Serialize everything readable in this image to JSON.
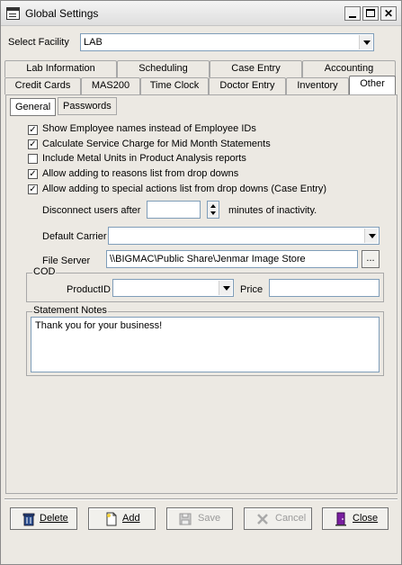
{
  "window": {
    "title": "Global Settings"
  },
  "facility": {
    "label": "Select Facility",
    "value": "LAB"
  },
  "tabs_row1": [
    "Lab Information",
    "Scheduling",
    "Case Entry",
    "Accounting"
  ],
  "tabs_row2": [
    "Credit Cards",
    "MAS200",
    "Time Clock",
    "Doctor Entry",
    "Inventory",
    "Other"
  ],
  "active_tab": "Other",
  "subtabs": [
    "General",
    "Passwords"
  ],
  "active_subtab": "General",
  "options": [
    {
      "label": "Show Employee names instead of Employee IDs",
      "checked": true
    },
    {
      "label": "Calculate Service Charge for Mid Month Statements",
      "checked": true
    },
    {
      "label": "Include Metal Units in Product Analysis reports",
      "checked": false
    },
    {
      "label": "Allow adding to reasons list from drop downs",
      "checked": true
    },
    {
      "label": "Allow adding to special actions list from drop downs (Case Entry)",
      "checked": true
    }
  ],
  "disconnect": {
    "label_before": "Disconnect users after",
    "value": "",
    "label_after": "minutes of inactivity."
  },
  "default_carrier": {
    "label": "Default Carrier",
    "value": ""
  },
  "file_server": {
    "label": "File Server",
    "value": "\\\\BIGMAC\\Public Share\\Jenmar Image Store",
    "browse_label": "..."
  },
  "cod": {
    "title": "COD",
    "product_label": "ProductID",
    "product_value": "",
    "price_label": "Price",
    "price_value": ""
  },
  "statement_notes": {
    "title": "Statement Notes",
    "value": "Thank you for your business!"
  },
  "buttons": {
    "delete": "Delete",
    "add": "Add",
    "save": "Save",
    "cancel": "Cancel",
    "close": "Close"
  },
  "colors": {
    "close_icon": "#7a1fa0",
    "delete_icon": "#2a4d8f"
  }
}
